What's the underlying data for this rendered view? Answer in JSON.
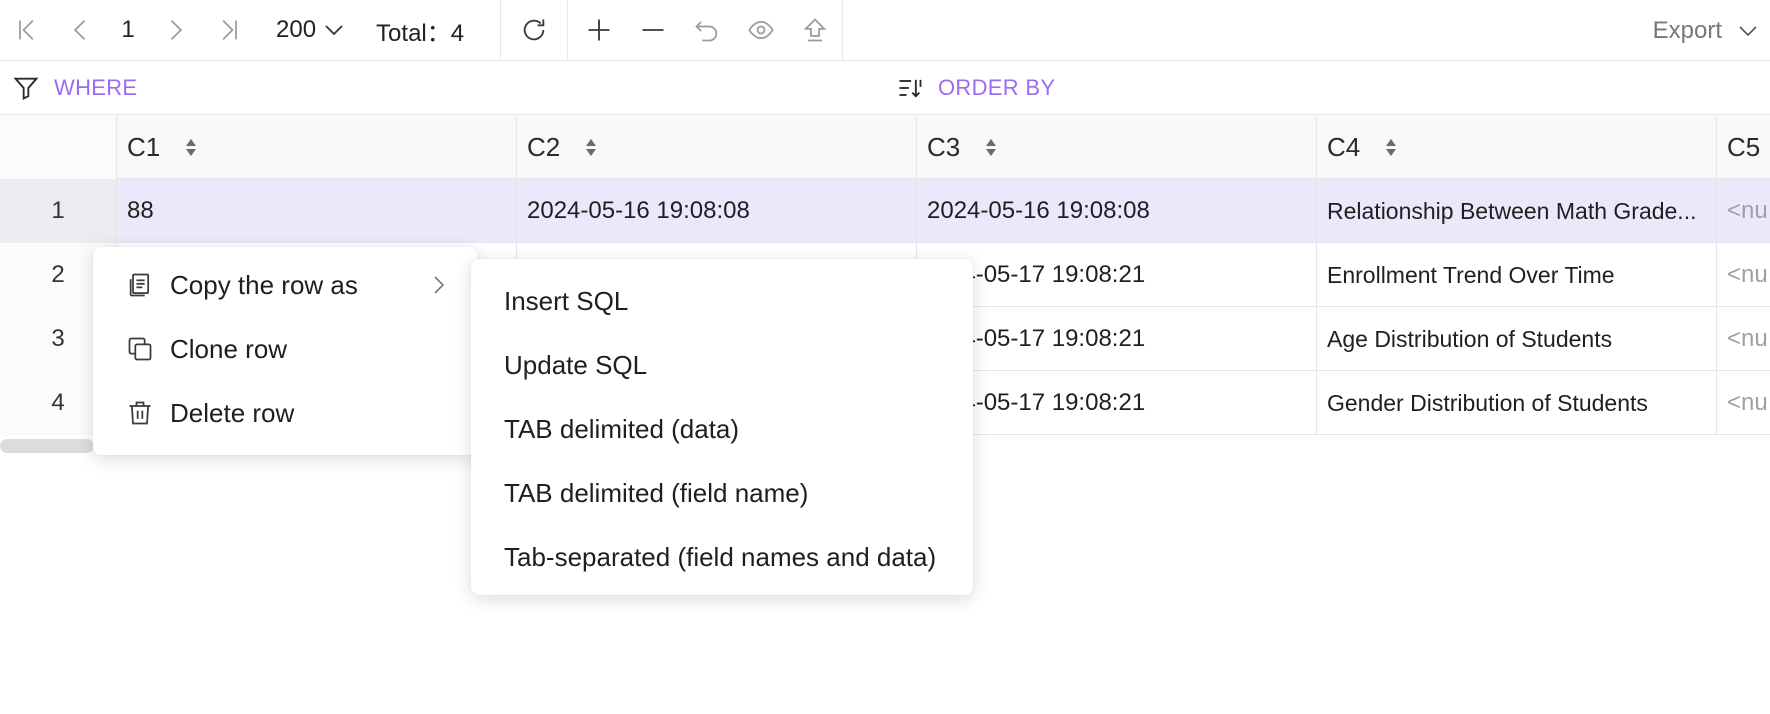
{
  "toolbar": {
    "page": "1",
    "page_size": "200",
    "total_label": "Total：",
    "total_value": "4",
    "export_label": "Export"
  },
  "filter": {
    "where_label": "WHERE",
    "order_by_label": "ORDER BY"
  },
  "columns": [
    "C1",
    "C2",
    "C3",
    "C4",
    "C5"
  ],
  "rows": [
    {
      "num": "1",
      "c1": "88",
      "c2": "2024-05-16 19:08:08",
      "c3": "2024-05-16 19:08:08",
      "c4": "Relationship Between Math Grade...",
      "c5": "<nu"
    },
    {
      "num": "2",
      "c3": "24-05-17 19:08:21",
      "c4": "Enrollment Trend Over Time",
      "c5": "<nu"
    },
    {
      "num": "3",
      "c3": "24-05-17 19:08:21",
      "c4": "Age Distribution of Students",
      "c5": "<nu"
    },
    {
      "num": "4",
      "c3": "24-05-17 19:08:21",
      "c4": "Gender Distribution of Students",
      "c5": "<nu"
    }
  ],
  "context_menu": {
    "items": [
      "Copy the row as",
      "Clone row",
      "Delete row"
    ]
  },
  "submenu": {
    "items": [
      "Insert SQL",
      "Update SQL",
      "TAB delimited (data)",
      "TAB delimited (field name)",
      "Tab-separated (field names and data)"
    ]
  },
  "colors": {
    "accent": "#9a6cf0",
    "selected_row": "#ece8fb"
  }
}
